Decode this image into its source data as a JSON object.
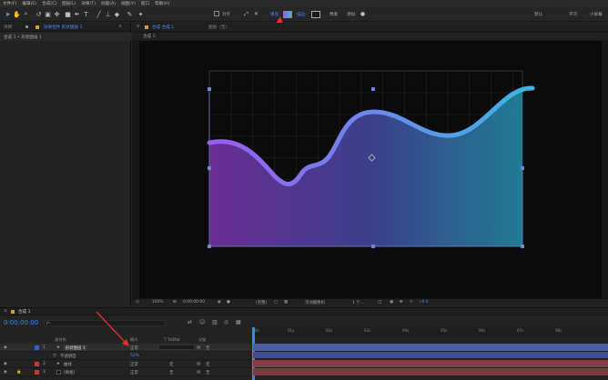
{
  "menu": [
    "文件(F)",
    "编辑(E)",
    "合成(C)",
    "图层(L)",
    "效果(T)",
    "动画(A)",
    "视图(V)",
    "窗口",
    "帮助(H)"
  ],
  "toolbar": {
    "align_label": "对齐",
    "fill_label": "填充:",
    "stroke_label": "描边:",
    "stroke_value": "像素",
    "add_label": "添加:",
    "workspace_default": "默认",
    "workspace_learn": "学习",
    "workspace_small": "小屏幕"
  },
  "left_panel": {
    "tab_project": "项目",
    "tab_effects": "效果控件 形状图层 1",
    "breadcrumb": "合成 1 • 形状图层 1"
  },
  "viewer": {
    "tab_comp": "合成 合成 1",
    "tab_layer": "图层（无）",
    "subtab": "合成 1",
    "zoom": "100%",
    "timecode": "0:00:00:00",
    "resolution": "(完整)",
    "camera": "活动摄像机",
    "views": "1 个...",
    "exposure": "+0.0"
  },
  "timeline": {
    "tab": "合成 1",
    "current_time": "0:00:00:00",
    "search_placeholder": "ρ₊",
    "ruler_ticks": [
      "0s",
      "01s",
      "02s",
      "03s",
      "04s",
      "05s",
      "06s",
      "07s",
      "08s"
    ],
    "columns": {
      "source": "源名称",
      "mode": "模式",
      "trkmat": "T TrkMat",
      "parent": "父级"
    },
    "layers": [
      {
        "num": "1",
        "name": "形状图层 1",
        "mode": "正常",
        "trkmat": "",
        "parent": "无",
        "color": "#3b5ccc",
        "selected": true
      },
      {
        "num": "2",
        "name": "曲线",
        "mode": "正常",
        "trkmat": "无",
        "parent": "无",
        "color": "#c43b3b",
        "selected": false
      },
      {
        "num": "3",
        "name": "[网格]",
        "mode": "正常",
        "trkmat": "无",
        "parent": "无",
        "color": "#c43b3b",
        "selected": false
      }
    ],
    "sub_row": "不透明度",
    "sub_row_value": "51%"
  },
  "colors": {
    "accent": "#4a8cff",
    "gradient_start": "#9b5cf0",
    "gradient_end": "#3ab6e6",
    "annotation_arrow": "#e03030"
  }
}
